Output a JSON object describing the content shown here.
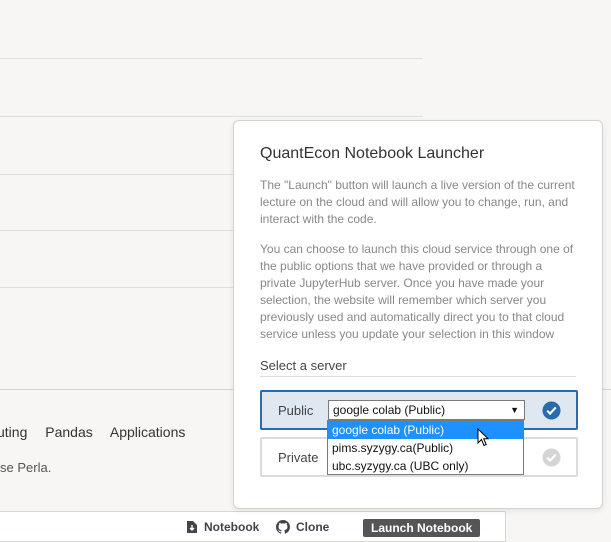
{
  "footer": {
    "links": [
      "uting",
      "Pandas",
      "Applications"
    ],
    "credit": "se Perla."
  },
  "toolbar": {
    "notebook_label": "Notebook",
    "clone_label": "Clone",
    "launch_label": "Launch Notebook"
  },
  "launcher": {
    "title": "QuantEcon Notebook Launcher",
    "para1": "The \"Launch\" button will launch a live version of the current lecture on the cloud and will allow you to change, run, and interact with the code.",
    "para2": "You can choose to launch this cloud service through one of the public options that we have provided or through a private JupyterHub server. Once you have made your selection, the website will remember which server you previously used and automatically direct you to that cloud service unless you update your selection in this window",
    "select_label": "Select a server",
    "public": {
      "label": "Public",
      "selected_value": "google colab (Public)",
      "options": [
        "google colab (Public)",
        "pims.syzygy.ca(Public)",
        "ubc.syzygy.ca (UBC only)"
      ]
    },
    "private": {
      "label": "Private"
    }
  },
  "colors": {
    "accent": "#2a6bb0",
    "selected_row_bg": "#dfe7f0",
    "dropdown_highlight": "#1e90ff",
    "check_inactive": "#d5d5d5"
  }
}
